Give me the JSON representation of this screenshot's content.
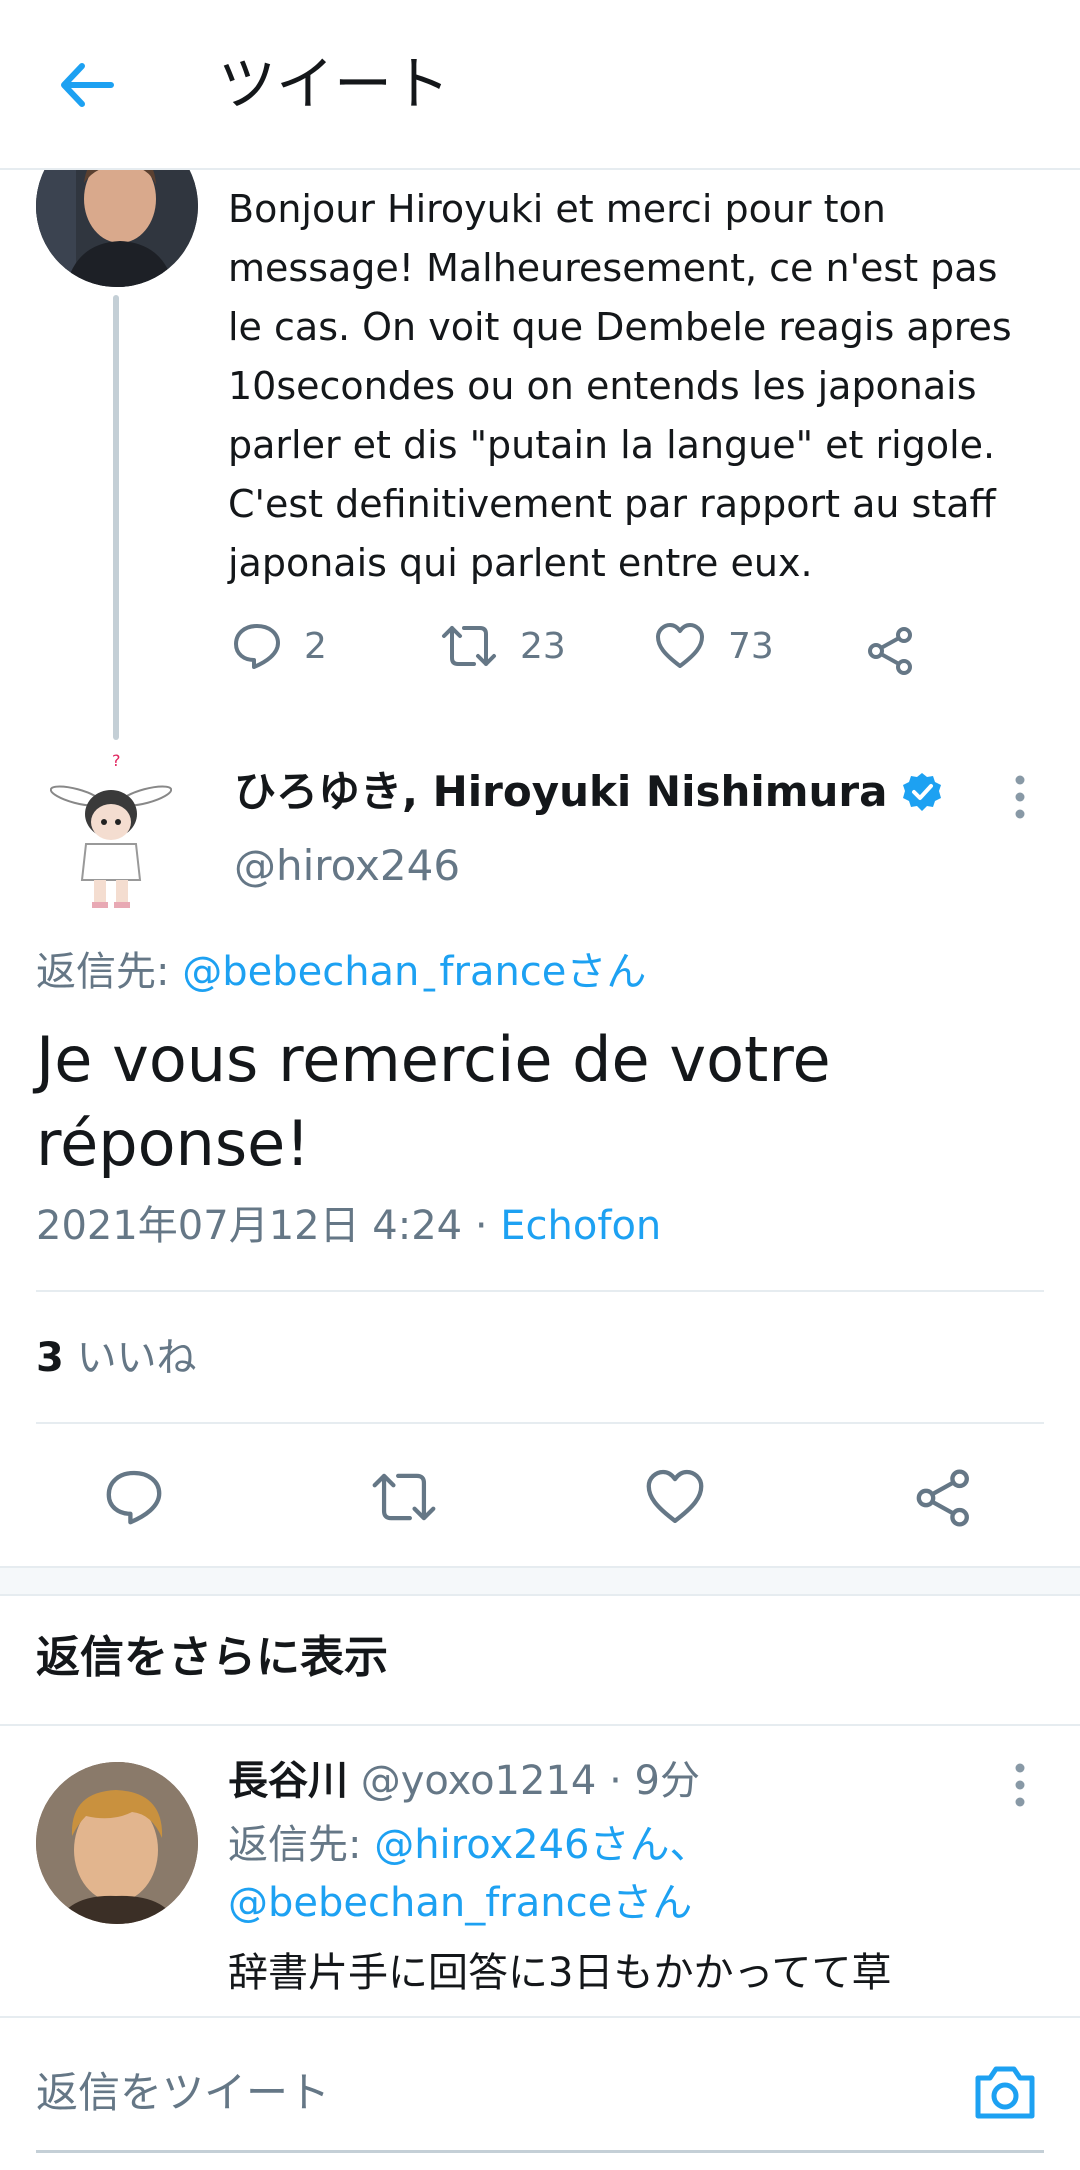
{
  "header": {
    "title": "ツイート"
  },
  "parent_tweet": {
    "text": "Bonjour Hiroyuki et merci pour ton\nmessage! Malheuresement, ce n'est pas\nle cas. On voit que Dembele reagis apres\n10secondes ou on entends les japonais\nparler et dis \"putain la langue\" et rigole.\nC'est definitivement par rapport au staff\njaponais qui parlent entre eux.",
    "replies": "2",
    "retweets": "23",
    "likes": "73"
  },
  "main_tweet": {
    "name": "ひろゆき, Hiroyuki Nishimura",
    "handle": "@hirox246",
    "reply_prefix": "返信先: ",
    "reply_to": "@bebechanˍfranceさん",
    "text": "Je vous remercie de votre réponse!",
    "timestamp": "2021年07月12日 4:24 · ",
    "client": "Echofon",
    "likes_count": "3",
    "likes_label": "いいね"
  },
  "more_replies": {
    "label": "返信をさらに表示"
  },
  "reply": {
    "name": "長谷川",
    "handle": "@yoxo1214",
    "time": "· 9分",
    "reply_prefix": "返信先: ",
    "reply_to_1": "@hirox246さん、",
    "reply_to_2": "@bebechan_franceさん",
    "text": "辞書片手に回答に3日もかかってて草"
  },
  "compose": {
    "placeholder": "返信をツイート"
  },
  "colors": {
    "accent": "#1da1f2",
    "secondary_text": "#657786",
    "divider": "#e6ecf0"
  }
}
